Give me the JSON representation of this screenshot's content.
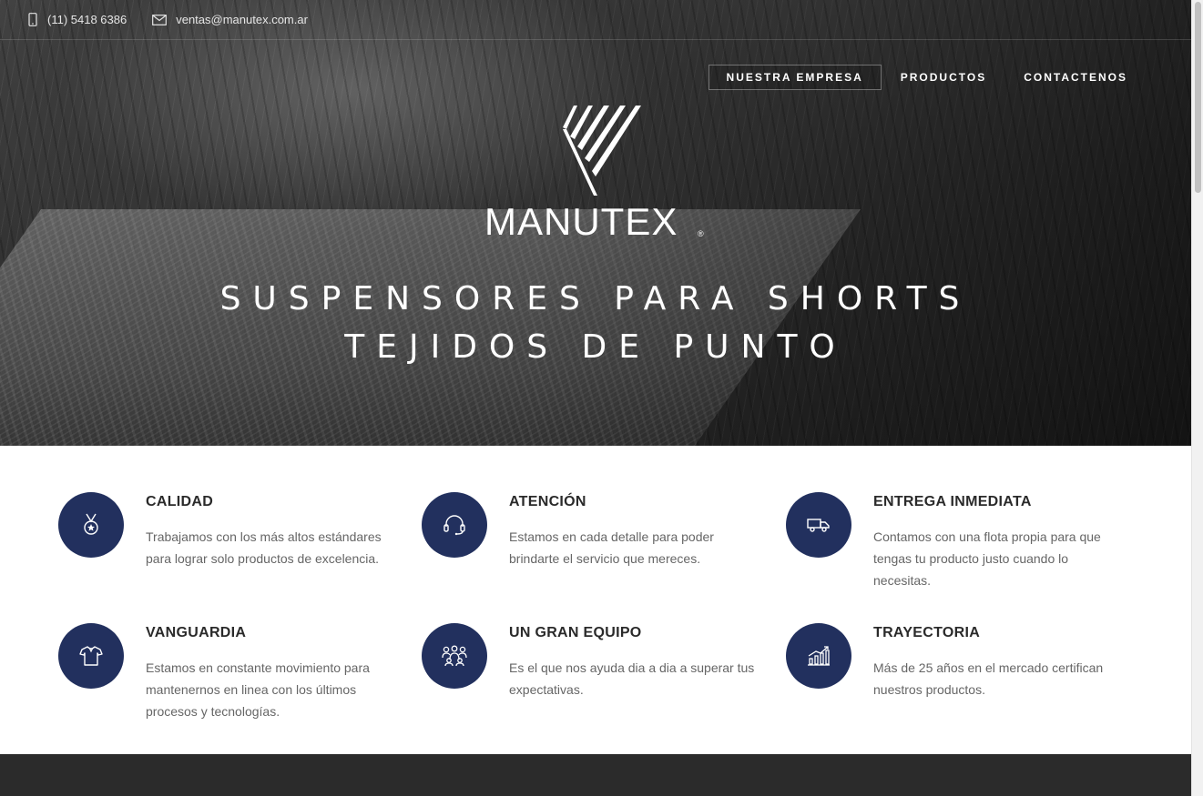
{
  "topbar": {
    "phone": "(11) 5418 6386",
    "email": "ventas@manutex.com.ar",
    "phone_icon": "mobile-phone-icon",
    "email_icon": "envelope-icon"
  },
  "nav": {
    "items": [
      {
        "label": "NUESTRA EMPRESA",
        "active": true
      },
      {
        "label": "PRODUCTOS",
        "active": false
      },
      {
        "label": "CONTACTENOS",
        "active": false
      }
    ]
  },
  "brand": {
    "name": "MANUTEX",
    "registered": "®"
  },
  "hero": {
    "line1": "SUSPENSORES PARA SHORTS",
    "line2": "TEJIDOS DE PUNTO"
  },
  "colors": {
    "accent": "#22305e",
    "dark_band": "#2b2b2b"
  },
  "features": [
    {
      "title": "CALIDAD",
      "desc": "Trabajamos con los más altos estándares para lograr solo productos de excelencia.",
      "icon": "medal-icon"
    },
    {
      "title": "ATENCIÓN",
      "desc": "Estamos en cada detalle para poder brindarte el servicio que mereces.",
      "icon": "headset-icon"
    },
    {
      "title": "ENTREGA INMEDIATA",
      "desc": "Contamos con una flota propia para que tengas tu producto justo cuando lo necesitas.",
      "icon": "truck-icon"
    },
    {
      "title": "VANGUARDIA",
      "desc": "Estamos en constante movimiento para mantenernos en linea con los últimos procesos y tecnologías.",
      "icon": "shirt-icon"
    },
    {
      "title": "UN GRAN EQUIPO",
      "desc": "Es el que nos ayuda dia a dia a superar tus expectativas.",
      "icon": "team-icon"
    },
    {
      "title": "TRAYECTORIA",
      "desc": "Más de 25 años en el mercado certifican nuestros productos.",
      "icon": "growth-chart-icon"
    }
  ]
}
